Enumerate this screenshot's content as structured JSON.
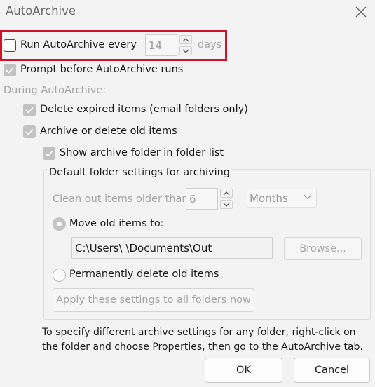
{
  "window": {
    "title": "AutoArchive"
  },
  "run_autoarchive": {
    "label": "Run AutoArchive every",
    "value": "14",
    "unit": "days"
  },
  "prompt": {
    "label": "Prompt before AutoArchive runs"
  },
  "during": {
    "label": "During AutoArchive:"
  },
  "delete_expired": {
    "label": "Delete expired items (email folders only)"
  },
  "archive_old": {
    "label": "Archive or delete old items"
  },
  "show_archive": {
    "label": "Show archive folder in folder list"
  },
  "group": {
    "title": "Default folder settings for archiving"
  },
  "clean_out": {
    "label": "Clean out items older than",
    "value": "6",
    "period": "Months"
  },
  "move_old": {
    "label": "Move old items to:",
    "path": "C:\\Users\\                    \\Documents\\Out"
  },
  "browse_button": {
    "label": "Browse..."
  },
  "permanently_delete": {
    "label": "Permanently delete old items"
  },
  "apply_button": {
    "label": "Apply these settings to all folders now"
  },
  "info_text": "To specify different archive settings for any folder, right-click on the folder and choose Properties, then go to the AutoArchive tab.",
  "ok_button": {
    "label": "OK"
  },
  "cancel_button": {
    "label": "Cancel"
  },
  "colors": {
    "highlight": "#d11124",
    "disabled_text": "#a5a5a5"
  }
}
